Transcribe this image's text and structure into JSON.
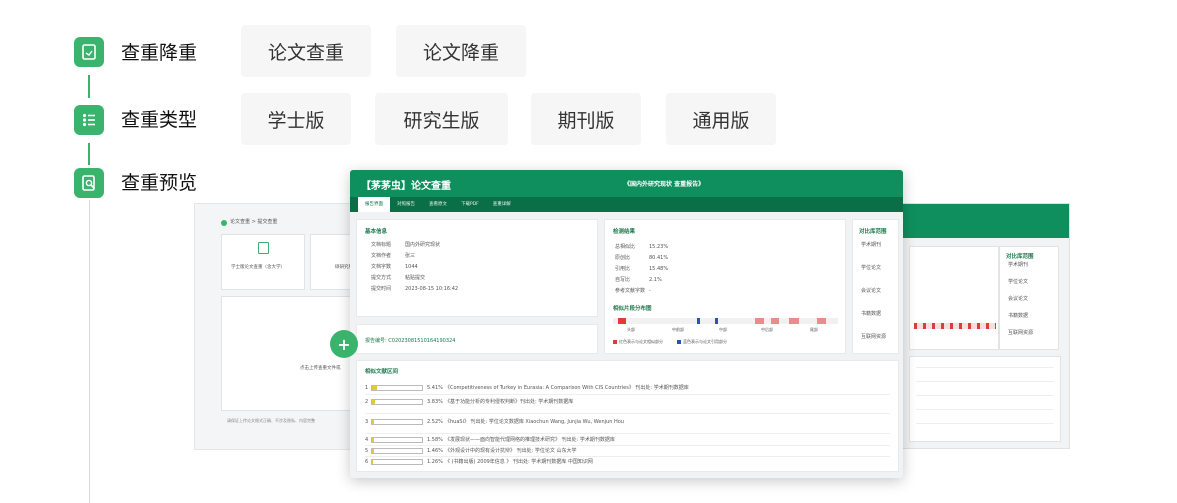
{
  "steps": [
    {
      "label": "查重降重",
      "options": [
        "论文查重",
        "论文降重"
      ]
    },
    {
      "label": "查重类型",
      "options": [
        "学士版",
        "研究生版",
        "期刊版",
        "通用版"
      ]
    },
    {
      "label": "查重预览",
      "options": []
    }
  ],
  "preview": {
    "header_title": "【茅茅虫】论文查重",
    "header_subtitle": "《国内外研究现状 查重报告》",
    "tabs": [
      "报告界面",
      "对照报告",
      "查看原文",
      "下载PDF",
      "查重详解"
    ],
    "basic_info": {
      "heading": "基本信息",
      "rows": [
        {
          "k": "文档标题",
          "v": "国内外研究现状"
        },
        {
          "k": "文档作者",
          "v": "张三"
        },
        {
          "k": "文档字数",
          "v": "1044"
        },
        {
          "k": "提交方式",
          "v": "粘贴提交"
        },
        {
          "k": "提交时间",
          "v": "2023-08-15 10:16:42"
        }
      ]
    },
    "check_result": {
      "heading": "检测结果",
      "rows": [
        {
          "k": "总相似比",
          "v": "15.23%"
        },
        {
          "k": "原创比",
          "v": "80.41%"
        },
        {
          "k": "引用比",
          "v": "15.48%"
        },
        {
          "k": "自写比",
          "v": "2.1%"
        },
        {
          "k": "参考文献字数",
          "v": "-"
        }
      ],
      "dist_heading": "相似片段分布图",
      "axis": [
        "头部",
        "中前部",
        "中部",
        "中后部",
        "尾部"
      ],
      "legend": [
        "红色表示与论文相似部分",
        "蓝色表示与论文引用部分"
      ]
    },
    "report_no": "报告编号: C02023081510164190324",
    "compare_scope": {
      "heading": "对比库范围",
      "items": [
        "学术期刊",
        "学位论文",
        "会议论文",
        "书籍数据",
        "互联网资源"
      ]
    },
    "similar_source": {
      "heading": "相似文献区间",
      "rows": [
        {
          "n": "1",
          "pct": "5.41%",
          "text": "《Competitiveness of Turkey in Eurasia: A Comparison With CIS Countries》 刊出处: 学术期刊数据库"
        },
        {
          "n": "2",
          "pct": "3.83%",
          "text": "《基于功能分析的专利侵权判断》刊出处: 学术期刊数据库"
        },
        {
          "n": "3",
          "pct": "2.52%",
          "text": "《huaSi》 刊出处: 学位论文数据库 Xiaochun Wang, Junjia Wu, Wenjun Hou"
        },
        {
          "n": "4",
          "pct": "1.58%",
          "text": "《发展现状——面向智能代理网络的推理技术研究》 刊出处: 学术期刊数据库"
        },
        {
          "n": "5",
          "pct": "1.46%",
          "text": "《外观设计中的现有设计抗辩》 刊出处: 学位论文 山东大学"
        },
        {
          "n": "6",
          "pct": "1.26%",
          "text": "《 (书籍出版) 2009年信息 》 刊出处: 学术期刊数据库 中国知识网"
        }
      ]
    },
    "left_panel": {
      "breadcrumb": "论文查重 > 提交查重",
      "card1": "学士版论文查重（含大学）",
      "card2": "硕研究版",
      "upload_hint": "点击上传查重文件或",
      "footer": "请保证上传论文格式正确、不涉及隐私、内容完整"
    },
    "right_panel": {
      "heading": "对比库范围",
      "items": [
        "学术期刊",
        "学位论文",
        "会议论文",
        "书籍数据",
        "互联网资源"
      ]
    }
  },
  "colors": {
    "brand_green": "#3ab36c",
    "report_green": "#0f8f5e",
    "similar_red": "#e03a3a",
    "cite_blue": "#2456b8"
  }
}
